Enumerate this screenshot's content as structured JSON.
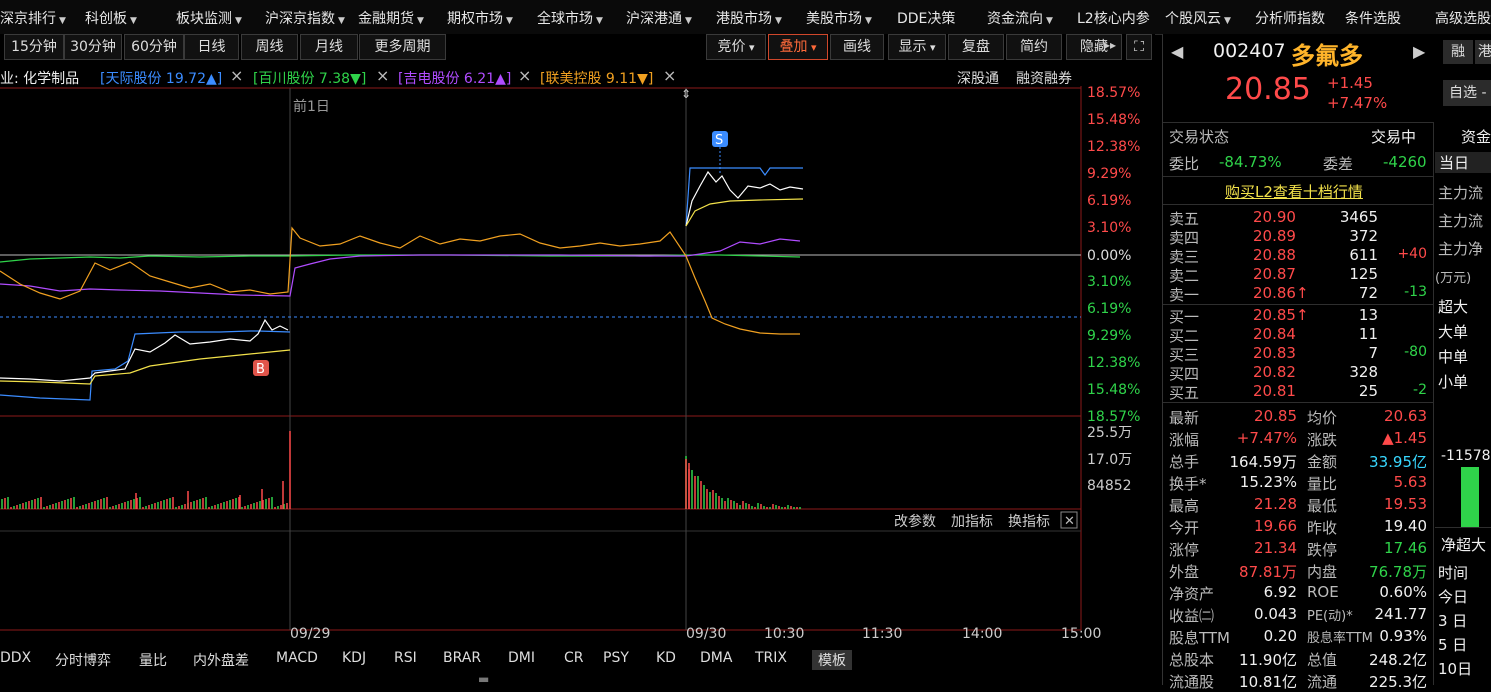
{
  "top_menu": [
    {
      "label": "深京排行",
      "arrow": true
    },
    {
      "label": "科创板",
      "arrow": true
    },
    {
      "label": "板块监测",
      "arrow": true
    },
    {
      "label": "沪深京指数",
      "arrow": true
    },
    {
      "label": "金融期货",
      "arrow": true
    },
    {
      "label": "期权市场",
      "arrow": true
    },
    {
      "label": "全球市场",
      "arrow": true
    },
    {
      "label": "沪深港通",
      "arrow": true
    },
    {
      "label": "港股市场",
      "arrow": true
    },
    {
      "label": "美股市场",
      "arrow": true
    },
    {
      "label": "DDE决策",
      "arrow": false
    },
    {
      "label": "资金流向",
      "arrow": true
    },
    {
      "label": "L2核心内参",
      "arrow": false
    },
    {
      "label": "个股风云",
      "arrow": true
    },
    {
      "label": "分析师指数",
      "arrow": false
    },
    {
      "label": "条件选股",
      "arrow": false
    },
    {
      "label": "高级选股",
      "arrow": false
    }
  ],
  "period_tabs": [
    "15分钟",
    "30分钟",
    "60分钟",
    "日线",
    "周线",
    "月线",
    "更多周期"
  ],
  "tools": {
    "bid": "竞价",
    "overlay": "叠加",
    "draw": "画线",
    "display": "显示",
    "replay": "复盘",
    "simple": "简约",
    "hide": "隐藏"
  },
  "overlay_bar": {
    "industry": "业: 化学制品",
    "stocks": [
      {
        "name": "[天际股份 19.72▲]",
        "color": "#3b8cff"
      },
      {
        "name": "[百川股份 7.38▼]",
        "color": "#2fd34a"
      },
      {
        "name": "[吉电股份 6.21▲]",
        "color": "#b04cff"
      },
      {
        "name": "[联美控股 9.11▼]",
        "color": "#f0a020"
      }
    ],
    "links": [
      "深股通",
      "融资融券"
    ]
  },
  "chart": {
    "prev_day_label": "前1日",
    "pct_up": [
      "18.57%",
      "15.48%",
      "12.38%",
      "9.29%",
      "6.19%",
      "3.10%"
    ],
    "pct_zero": "0.00%",
    "pct_down": [
      "3.10%",
      "6.19%",
      "9.29%",
      "12.38%",
      "15.48%",
      "18.57%"
    ],
    "vol_labels": [
      "25.5万",
      "17.0万",
      "84852"
    ],
    "param_links": [
      "改参数",
      "加指标",
      "换指标"
    ],
    "time_labels": [
      "09/29",
      "09/30",
      "10:30",
      "11:30",
      "14:00",
      "15:00"
    ],
    "markers": {
      "sell": "S",
      "buy": "B"
    }
  },
  "indicator_tabs": [
    "DDX",
    "分时博弈",
    "量比",
    "内外盘差",
    "MACD",
    "KDJ",
    "RSI",
    "BRAR",
    "DMI",
    "CR",
    "PSY",
    "KD",
    "DMA",
    "TRIX",
    "模板"
  ],
  "quote": {
    "code": "002407",
    "name": "多氟多",
    "price": "20.85",
    "change": "+1.45",
    "pct": "+7.47%",
    "side_buttons": [
      "融",
      "港"
    ],
    "watch": "自选 -",
    "status_label": "交易状态",
    "status": "交易中",
    "weibi_label": "委比",
    "weibi": "-84.73%",
    "weicha_label": "委差",
    "weicha": "-4260",
    "l2_link": "购买L2查看十档行情",
    "asks": [
      {
        "label": "卖五",
        "price": "20.90",
        "vol": "3465",
        "chg": ""
      },
      {
        "label": "卖四",
        "price": "20.89",
        "vol": "372",
        "chg": ""
      },
      {
        "label": "卖三",
        "price": "20.88",
        "vol": "611",
        "chg": "+40"
      },
      {
        "label": "卖二",
        "price": "20.87",
        "vol": "125",
        "chg": ""
      },
      {
        "label": "卖一",
        "price": "20.86↑",
        "vol": "72",
        "chg": "-13"
      }
    ],
    "bids": [
      {
        "label": "买一",
        "price": "20.85↑",
        "vol": "13",
        "chg": ""
      },
      {
        "label": "买二",
        "price": "20.84",
        "vol": "11",
        "chg": ""
      },
      {
        "label": "买三",
        "price": "20.83",
        "vol": "7",
        "chg": "-80"
      },
      {
        "label": "买四",
        "price": "20.82",
        "vol": "328",
        "chg": ""
      },
      {
        "label": "买五",
        "price": "20.81",
        "vol": "25",
        "chg": "-2"
      }
    ],
    "stats": [
      {
        "l": "最新",
        "v": "20.85",
        "vc": "red",
        "l2": "均价",
        "v2": "20.63",
        "v2c": "red"
      },
      {
        "l": "涨幅",
        "v": "+7.47%",
        "vc": "red",
        "l2": "涨跌",
        "v2": "▲1.45",
        "v2c": "red"
      },
      {
        "l": "总手",
        "v": "164.59万",
        "vc": "white",
        "l2": "金额",
        "v2": "33.95亿",
        "v2c": "cyan"
      },
      {
        "l": "换手*",
        "v": "15.23%",
        "vc": "white",
        "l2": "量比",
        "v2": "5.63",
        "v2c": "red"
      },
      {
        "l": "最高",
        "v": "21.28",
        "vc": "red",
        "l2": "最低",
        "v2": "19.53",
        "v2c": "red"
      },
      {
        "l": "今开",
        "v": "19.66",
        "vc": "red",
        "l2": "昨收",
        "v2": "19.40",
        "v2c": "white"
      },
      {
        "l": "涨停",
        "v": "21.34",
        "vc": "red",
        "l2": "跌停",
        "v2": "17.46",
        "v2c": "green"
      },
      {
        "l": "外盘",
        "v": "87.81万",
        "vc": "red",
        "l2": "内盘",
        "v2": "76.78万",
        "v2c": "green"
      },
      {
        "l": "净资产",
        "v": "6.92",
        "vc": "white",
        "l2": "ROE",
        "v2": "0.60%",
        "v2c": "white"
      },
      {
        "l": "收益㈡",
        "v": "0.043",
        "vc": "white",
        "l2": "PE(动)*",
        "v2": "241.77",
        "v2c": "white"
      },
      {
        "l": "股息TTM",
        "v": "0.20",
        "vc": "white",
        "l2": "股息率TTM",
        "v2": "0.93%",
        "v2c": "white"
      },
      {
        "l": "总股本",
        "v": "11.90亿",
        "vc": "white",
        "l2": "总值",
        "v2": "248.2亿",
        "v2c": "white"
      },
      {
        "l": "流通股",
        "v": "10.81亿",
        "vc": "white",
        "l2": "流通",
        "v2": "225.3亿",
        "v2c": "white"
      }
    ],
    "fund_tab": "资金",
    "today_tab": "当日",
    "fund_rows": [
      "主力流",
      "主力流",
      "主力净"
    ],
    "unit": "(万元)",
    "size_rows": [
      "超大",
      "大单",
      "中单",
      "小单"
    ],
    "bar_value": "-11578",
    "net_label": "净超大",
    "time_rows": [
      "时间",
      "今日",
      "3 日",
      "5 日",
      "10日"
    ]
  },
  "colors": {
    "up": "#ff4a4a",
    "down": "#2fd34a",
    "accent": "#d0472b",
    "zero_line": "#ffffff",
    "price_line": "#ffffff",
    "avg_line": "#f2e14a"
  }
}
